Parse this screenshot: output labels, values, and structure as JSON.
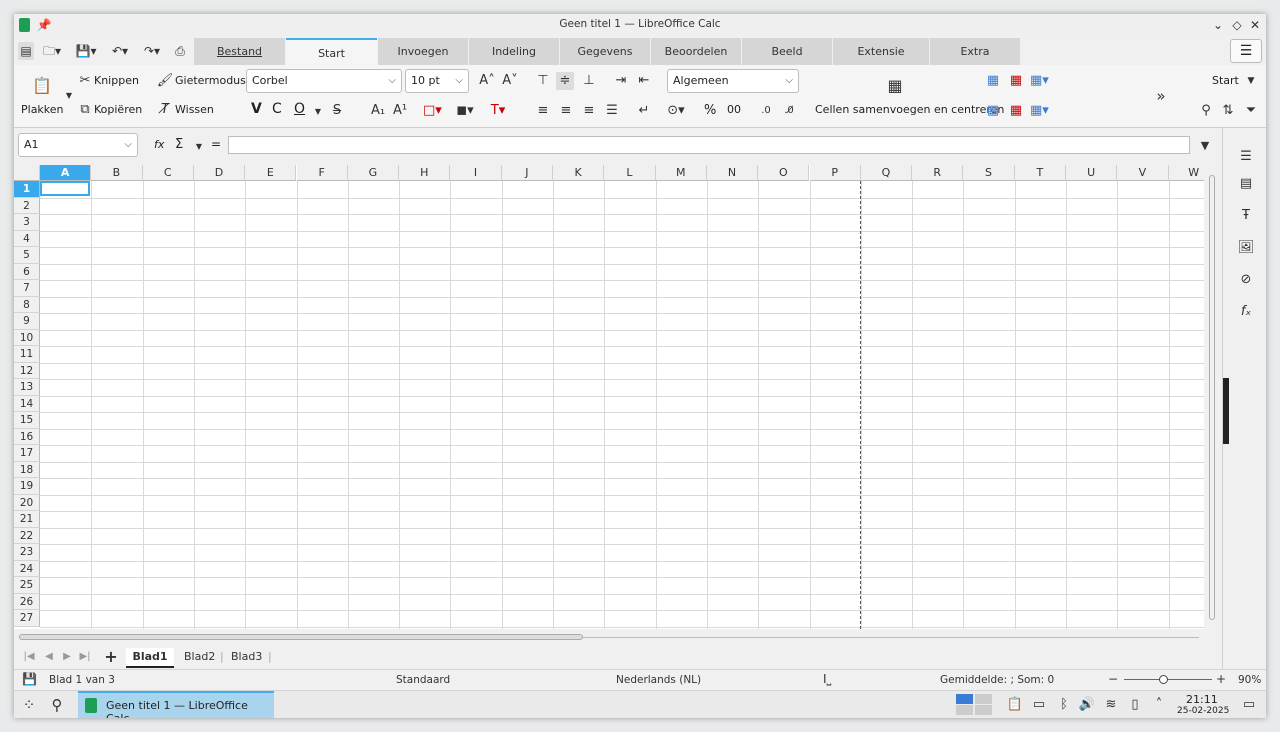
{
  "window": {
    "title": "Geen titel 1 — LibreOffice Calc"
  },
  "tabs": [
    "Bestand",
    "Start",
    "Invoegen",
    "Indeling",
    "Gegevens",
    "Beoordelen",
    "Beeld",
    "Extensie",
    "Extra"
  ],
  "active_tab": "Start",
  "ribbon": {
    "paste": "Plakken",
    "cut": "Knippen",
    "copy": "Kopiëren",
    "clone": "Gietermodus",
    "clear": "Wissen",
    "font_name": "Corbel",
    "font_size": "10 pt",
    "number_format": "Algemeen",
    "bold": "V",
    "italic": "C",
    "underline": "O",
    "percent": "%",
    "decimal": "00",
    "merge": "Cellen samenvoegen en centreren",
    "style": "Start"
  },
  "formula": {
    "name_box": "A1",
    "fx": "fx",
    "sum": "Σ",
    "equals": "=",
    "content": ""
  },
  "columns": [
    "A",
    "B",
    "C",
    "D",
    "E",
    "F",
    "G",
    "H",
    "I",
    "J",
    "K",
    "L",
    "M",
    "N",
    "O",
    "P",
    "Q",
    "R",
    "S",
    "T",
    "U",
    "V",
    "W"
  ],
  "rows": [
    "1",
    "2",
    "3",
    "4",
    "5",
    "6",
    "7",
    "8",
    "9",
    "10",
    "11",
    "12",
    "13",
    "14",
    "15",
    "16",
    "17",
    "18",
    "19",
    "20",
    "21",
    "22",
    "23",
    "24",
    "25",
    "26",
    "27"
  ],
  "sheets": [
    "Blad1",
    "Blad2",
    "Blad3"
  ],
  "active_sheet": "Blad1",
  "status": {
    "sheet_info": "Blad 1 van 3",
    "page_style": "Standaard",
    "language": "Nederlands (NL)",
    "summary": "Gemiddelde: ; Som: 0",
    "zoom": "90%"
  },
  "taskbar": {
    "app_label": "Geen titel 1 — LibreOffice Calc",
    "time": "21:11",
    "date": "25-02-2025"
  },
  "colors": {
    "accent": "#3daee9",
    "selection": "#39a9eb",
    "calc_green": "#1e9e55"
  }
}
